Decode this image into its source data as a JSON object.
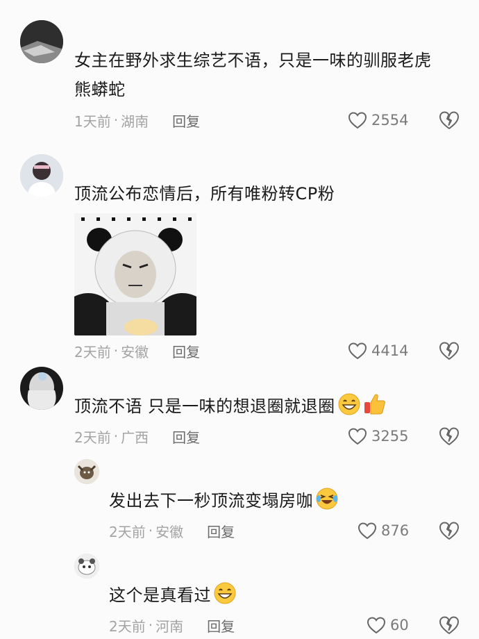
{
  "comments": [
    {
      "text_line1": "女主在野外求生综艺不语，只是一味的驯服老虎",
      "text_line2": "熊蟒蛇",
      "time": "1天前",
      "location": "湖南",
      "reply_label": "回复",
      "likes": "2554"
    },
    {
      "text": "顶流公布恋情后，所有唯粉转CP粉",
      "time": "2天前",
      "location": "安徽",
      "reply_label": "回复",
      "likes": "4414"
    },
    {
      "text": "顶流不语 只是一味的想退圈就退圈",
      "time": "2天前",
      "location": "广西",
      "reply_label": "回复",
      "likes": "3255"
    },
    {
      "text": "发出去下一秒顶流变塌房咖",
      "time": "2天前",
      "location": "安徽",
      "reply_label": "回复",
      "likes": "876"
    },
    {
      "text": "这个是真看过",
      "time": "2天前",
      "location": "河南",
      "reply_label": "回复",
      "likes": "60"
    }
  ],
  "separator": "·",
  "colors": {
    "meta_gray": "#a3a3a3",
    "reply_gray": "#6b6b6b",
    "text_dark": "#1a1a1a",
    "background": "#fbfbfb"
  },
  "icons": [
    "heart-icon",
    "broken-heart-icon",
    "grin-emoji",
    "thumbs-up-emoji",
    "laughing-tears-emoji"
  ]
}
